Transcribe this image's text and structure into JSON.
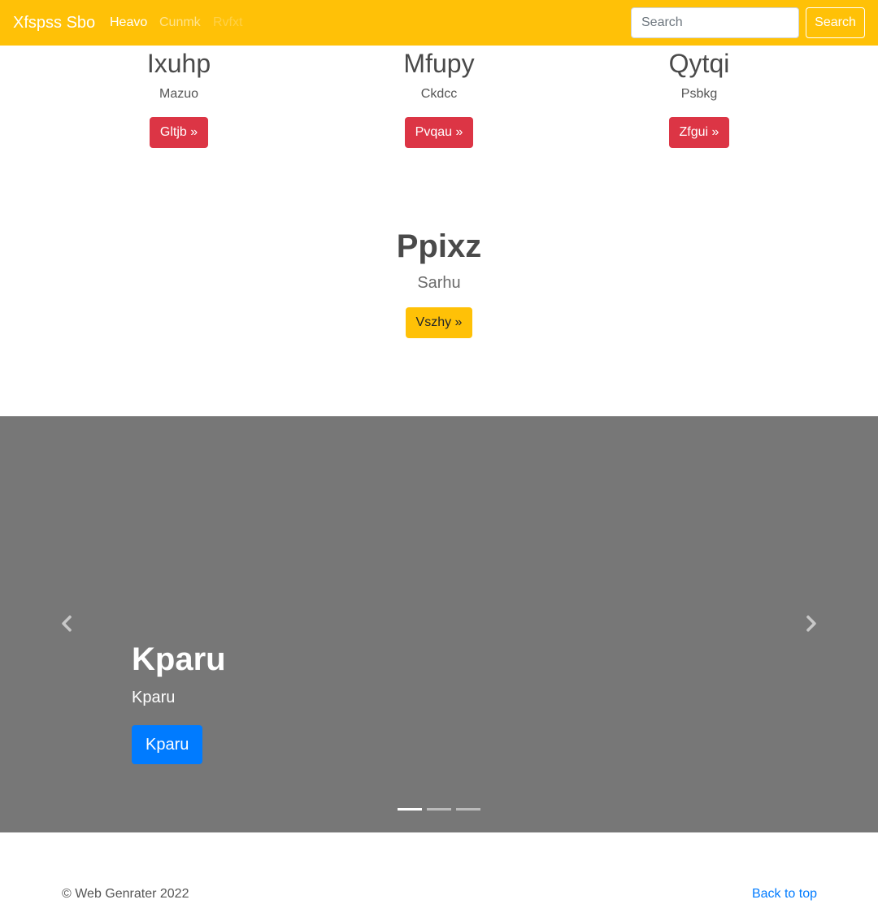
{
  "navbar": {
    "brand": "Xfspss Sbo",
    "links": [
      "Heavo",
      "Cunmk",
      "Rvfxt"
    ],
    "search_placeholder": "Search",
    "search_button": "Search",
    "background_color": "#ffc107"
  },
  "columns": [
    {
      "heading": "Ixuhp",
      "text": "Mazuo",
      "button": "Gltjb »"
    },
    {
      "heading": "Mfupy",
      "text": "Ckdcc",
      "button": "Pvqau »"
    },
    {
      "heading": "Qytqi",
      "text": "Psbkg",
      "button": "Zfgui »"
    }
  ],
  "featured": {
    "heading": "Ppixz",
    "text": "Sarhu",
    "button": "Vszhy »"
  },
  "carousel": {
    "background_color": "#777777",
    "caption_heading": "Kparu",
    "caption_text": "Kparu",
    "caption_button": "Kparu",
    "prev_icon": "chevron-left-icon",
    "next_icon": "chevron-right-icon",
    "slide_count": 3,
    "active_slide": 1
  },
  "footer": {
    "copyright": "© Web Genrater 2022",
    "back_to_top": "Back to top"
  }
}
